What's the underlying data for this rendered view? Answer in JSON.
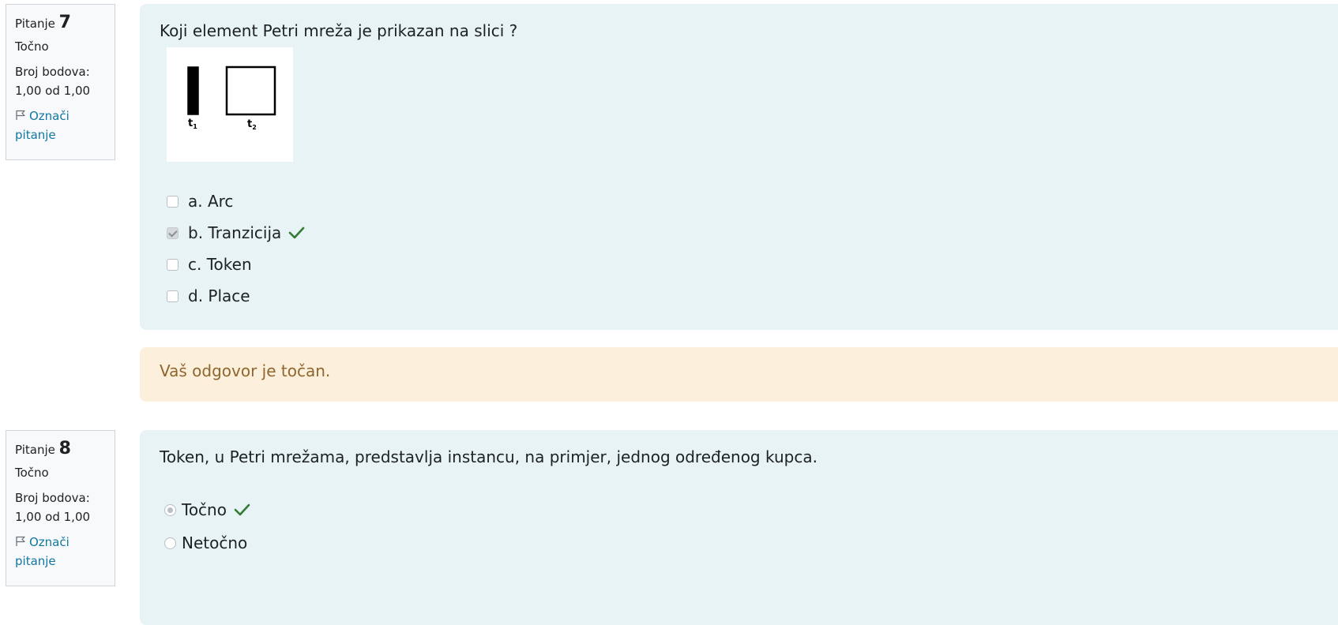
{
  "questions": [
    {
      "label": "Pitanje",
      "number": "7",
      "state": "Točno",
      "grade_label": "Broj bodova:",
      "grade_value": "1,00 od 1,00",
      "flag_line1": "Označi",
      "flag_line2": "pitanje",
      "text": "Koji element Petri mreža je prikazan na slici ?",
      "image_labels": [
        "t1",
        "t2"
      ],
      "options": [
        {
          "label": "a. Arc",
          "checked": false,
          "correct": false
        },
        {
          "label": "b. Tranzicija",
          "checked": true,
          "correct": true
        },
        {
          "label": "c. Token",
          "checked": false,
          "correct": false
        },
        {
          "label": "d. Place",
          "checked": false,
          "correct": false
        }
      ],
      "feedback": "Vaš odgovor je točan."
    },
    {
      "label": "Pitanje",
      "number": "8",
      "state": "Točno",
      "grade_label": "Broj bodova:",
      "grade_value": "1,00 od 1,00",
      "flag_line1": "Označi",
      "flag_line2": "pitanje",
      "text": "Token, u Petri mrežama, predstavlja instancu, na primjer, jednog određenog kupca.",
      "options": [
        {
          "label": "Točno",
          "checked": true,
          "correct": true
        },
        {
          "label": "Netočno",
          "checked": false,
          "correct": false
        }
      ]
    }
  ],
  "colors": {
    "formulation_bg": "#e7f3f5",
    "outcome_bg": "#fcefdc",
    "outcome_text": "#8e662e",
    "link": "#1177a3",
    "correct_tick": "#357a32"
  }
}
